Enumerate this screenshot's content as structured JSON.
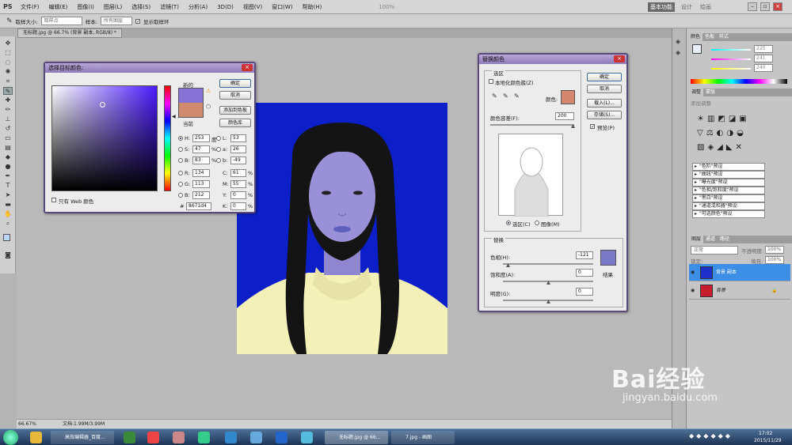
{
  "app": {
    "logo": "PS",
    "menu": [
      "文件(F)",
      "编辑(E)",
      "图像(I)",
      "图层(L)",
      "选择(S)",
      "滤镜(T)",
      "分析(A)",
      "3D(D)",
      "视图(V)",
      "窗口(W)",
      "帮助(H)"
    ],
    "zoom_display": "100%",
    "workspace": "基本功能",
    "workspace_others": [
      "设计",
      "绘画"
    ]
  },
  "options": {
    "sample_size_label": "取样大小:",
    "sample_size_value": "取样点",
    "sample_label": "样本:",
    "sample_value": "所有图层",
    "show_ring": "显示取样环"
  },
  "document": {
    "tab": "无标题.jpg @ 66.7% (背景 副本, RGB/8) *",
    "zoom": "66.67%",
    "doc_size": "文档:1.99M/3.99M"
  },
  "picker": {
    "title": "选择目标颜色:",
    "new_label": "新的",
    "current_label": "当前",
    "ok": "确定",
    "cancel": "取消",
    "add_swatch": "添加到色板",
    "libraries": "颜色库",
    "web_only": "只有 Web 颜色",
    "H": "253",
    "H_unit": "度",
    "S": "47",
    "B": "83",
    "R": "134",
    "G": "113",
    "Bv": "212",
    "L": "53",
    "a": "26",
    "b": "-49",
    "C": "61",
    "M": "55",
    "Y": "0",
    "K": "0",
    "hex": "8671d4",
    "pct": "%",
    "labels": {
      "H": "H:",
      "S": "S:",
      "B": "B:",
      "R": "R:",
      "G": "G:",
      "Bv": "B:",
      "L": "L:",
      "a": "a:",
      "b": "b:",
      "C": "C:",
      "M": "M:",
      "Y": "Y:",
      "K": "K:",
      "hex": "#"
    },
    "new_color": "#8671d4",
    "current_color": "#d08a6e"
  },
  "replace": {
    "title": "替换颜色",
    "selection_section": "选区",
    "localized": "本地化颜色簇(Z)",
    "color_label": "颜色:",
    "tolerance_label": "颜色容差(F):",
    "tolerance": "200",
    "opt_selection": "选区(C)",
    "opt_image": "图像(M)",
    "replace_section": "替换",
    "hue_label": "色相(H):",
    "hue": "-121",
    "sat_label": "饱和度(A):",
    "sat": "0",
    "light_label": "明度(G):",
    "light": "0",
    "result_label": "结果",
    "ok": "确定",
    "cancel": "取消",
    "load": "载入(L)...",
    "save": "存储(S)...",
    "preview": "预览(P)",
    "sample_color": "#d4876c",
    "result_color": "#7a78c8"
  },
  "panels": {
    "color_tabs": [
      "颜色",
      "色板",
      "样式"
    ],
    "rgb": [
      "225",
      "241",
      "240"
    ],
    "adjust_tabs": [
      "调整",
      "蒙版"
    ],
    "adjust_hint": "添加调整",
    "presets": [
      "\"色阶\"预设",
      "\"曲线\"预设",
      "\"曝光度\"预设",
      "\"色相/饱和度\"预设",
      "\"黑白\"预设",
      "\"通道混和器\"预设",
      "\"可选颜色\"预设"
    ],
    "layer_tabs": [
      "图层",
      "通道",
      "路径"
    ],
    "blend": "正常",
    "opacity_label": "不透明度:",
    "opacity": "100%",
    "lock_label": "锁定:",
    "fill_label": "填充:",
    "fill": "100%",
    "layers": [
      {
        "name": "背景 副本"
      },
      {
        "name": "背景"
      }
    ]
  },
  "taskbar": {
    "items": [
      "高效编辑器_百度...",
      "无标题.jpg @ 66...",
      "7.jpg - 画图"
    ],
    "time": "17:02",
    "date": "2015/11/29"
  },
  "watermark": {
    "brand": "Bai经验",
    "url": "jingyan.baidu.com"
  }
}
